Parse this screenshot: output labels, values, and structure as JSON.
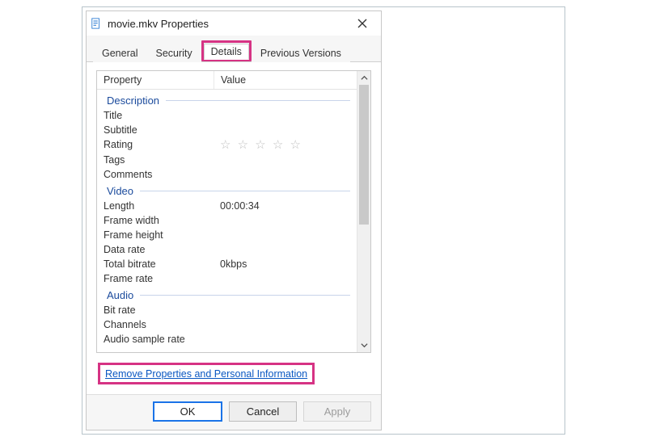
{
  "window": {
    "title": "movie.mkv Properties"
  },
  "tabs": {
    "general": "General",
    "security": "Security",
    "details": "Details",
    "previous_versions": "Previous Versions"
  },
  "list": {
    "head_property": "Property",
    "head_value": "Value",
    "groups": {
      "description": "Description",
      "video": "Video",
      "audio": "Audio"
    },
    "description": {
      "title_label": "Title",
      "title_value": "",
      "subtitle_label": "Subtitle",
      "subtitle_value": "",
      "rating_label": "Rating",
      "rating_value": "☆ ☆ ☆ ☆ ☆",
      "tags_label": "Tags",
      "tags_value": "",
      "comments_label": "Comments",
      "comments_value": ""
    },
    "video": {
      "length_label": "Length",
      "length_value": "00:00:34",
      "frame_width_label": "Frame width",
      "frame_width_value": "",
      "frame_height_label": "Frame height",
      "frame_height_value": "",
      "data_rate_label": "Data rate",
      "data_rate_value": "",
      "total_bitrate_label": "Total bitrate",
      "total_bitrate_value": "0kbps",
      "frame_rate_label": "Frame rate",
      "frame_rate_value": ""
    },
    "audio": {
      "bit_rate_label": "Bit rate",
      "bit_rate_value": "",
      "channels_label": "Channels",
      "channels_value": "",
      "audio_sample_rate_label": "Audio sample rate",
      "audio_sample_rate_value": ""
    }
  },
  "link": {
    "remove_label": "Remove Properties and Personal Information"
  },
  "buttons": {
    "ok": "OK",
    "cancel": "Cancel",
    "apply": "Apply"
  }
}
